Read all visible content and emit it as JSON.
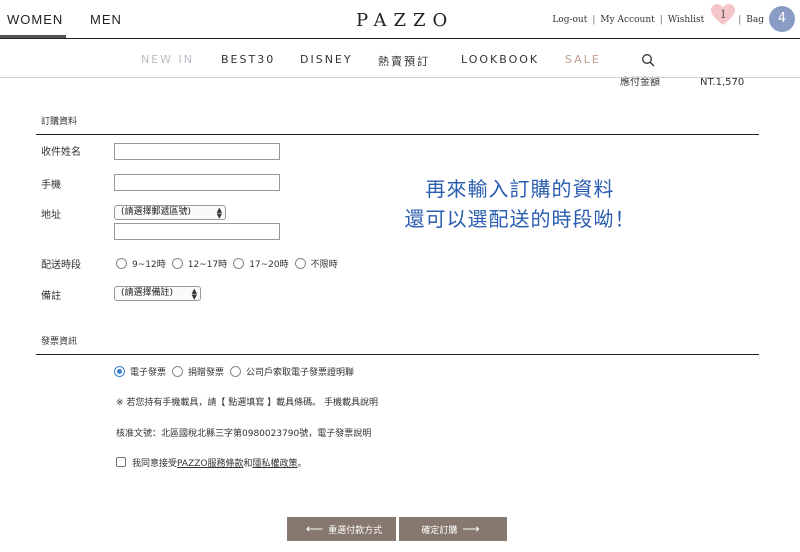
{
  "header": {
    "women": "WOMEN",
    "men": "MEN",
    "logo": "PAZZO",
    "logout": "Log-out",
    "my_account": "My Account",
    "wishlist": "Wishlist",
    "wishlist_count": "1",
    "bag": "Bag",
    "bag_count": "4",
    "sep": "|"
  },
  "nav": {
    "items": [
      "NEW IN",
      "BEST30",
      "DISNEY",
      "熱賣預訂",
      "LOOKBOOK",
      "SALE"
    ]
  },
  "summary": {
    "label": "應付金額",
    "amount": "NT.1,570"
  },
  "order": {
    "section_title": "訂購資料",
    "name_label": "收件姓名",
    "phone_label": "手機",
    "address_label": "地址",
    "address_select": "(請選擇郵遞區號)",
    "time_label": "配送時段",
    "time_options": [
      "9~12時",
      "12~17時",
      "17~20時",
      "不限時"
    ],
    "note_label": "備註",
    "note_select": "(請選擇備註)"
  },
  "invoice": {
    "section_title": "發票資訊",
    "options": [
      "電子發票",
      "捐贈發票",
      "公司戶索取電子發票證明聯"
    ],
    "mobile_note": "※ 若您持有手機載具，請【 點選填寫 】載具條碼。 手機載具說明",
    "approval_note": "核准文號：北區國稅北縣三字第0980023790號，電子發票說明",
    "agree_prefix": "我同意接受",
    "agree_terms": "PAZZO服務條款",
    "agree_and": "和",
    "agree_privacy": "隱私權政策",
    "agree_suffix": "。"
  },
  "overlay": {
    "line1": "再來輸入訂購的資料",
    "line2": "還可以選配送的時段呦！"
  },
  "buttons": {
    "back": "重選付款方式",
    "confirm": "確定訂購"
  },
  "colors": {
    "accent_blue": "#3d7fd1",
    "overlay_blue": "#2a5db0",
    "button_brown": "#86786e",
    "bag_badge": "#8a9cc6",
    "heart_pink": "#f4c6cc"
  }
}
